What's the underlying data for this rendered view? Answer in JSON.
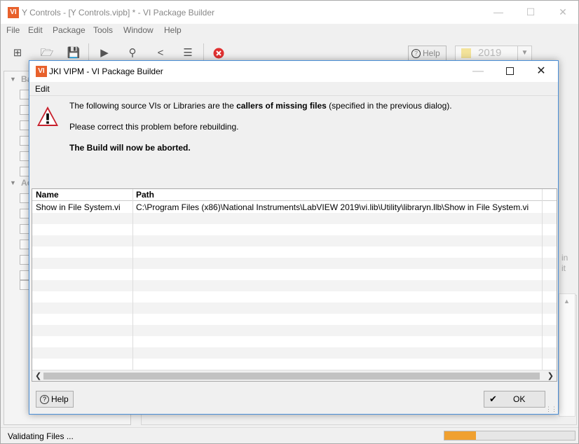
{
  "main_window": {
    "logo": "VI",
    "title": "Y Controls - [Y Controls.vipb] * - VI Package Builder",
    "menu": [
      "File",
      "Edit",
      "Package",
      "Tools",
      "Window",
      "Help"
    ],
    "toolbar": {
      "help_label": "Help",
      "version_value": "2019",
      "icons": [
        "add-icon",
        "open-folder-icon",
        "save-icon",
        "run-icon",
        "search-icon",
        "share-icon",
        "list-icon",
        "stop-icon"
      ]
    },
    "left_panel": {
      "section_1_partial": "Ba",
      "section_2_partial": "Ac"
    },
    "background_text": {
      "line1": "in",
      "line2": "it"
    },
    "status_text": "Validating Files ...",
    "progress": 0.24
  },
  "dialog": {
    "logo": "VI",
    "title": "JKI VIPM - VI Package Builder",
    "menu_edit": "Edit",
    "message": {
      "line1_pre": "The following source VIs or Libraries are the ",
      "line1_bold": "callers of missing files",
      "line1_post": " (specified in the previous dialog).",
      "line2": "Please correct this problem before rebuilding.",
      "line3": "The Build will now be aborted."
    },
    "table": {
      "columns": [
        "Name",
        "Path"
      ],
      "rows": [
        {
          "name": "Show in File System.vi",
          "path": "C:\\Program Files (x86)\\National Instruments\\LabVIEW 2019\\vi.lib\\Utility\\libraryn.llb\\Show in File System.vi"
        }
      ]
    },
    "help_button": "Help",
    "ok_button": "OK"
  },
  "colors": {
    "vi_logo": "#e8612c",
    "dialog_border": "#4a8fd8",
    "warning": "#c8202c",
    "stop": "#e03030",
    "progress": "#f0a030"
  }
}
